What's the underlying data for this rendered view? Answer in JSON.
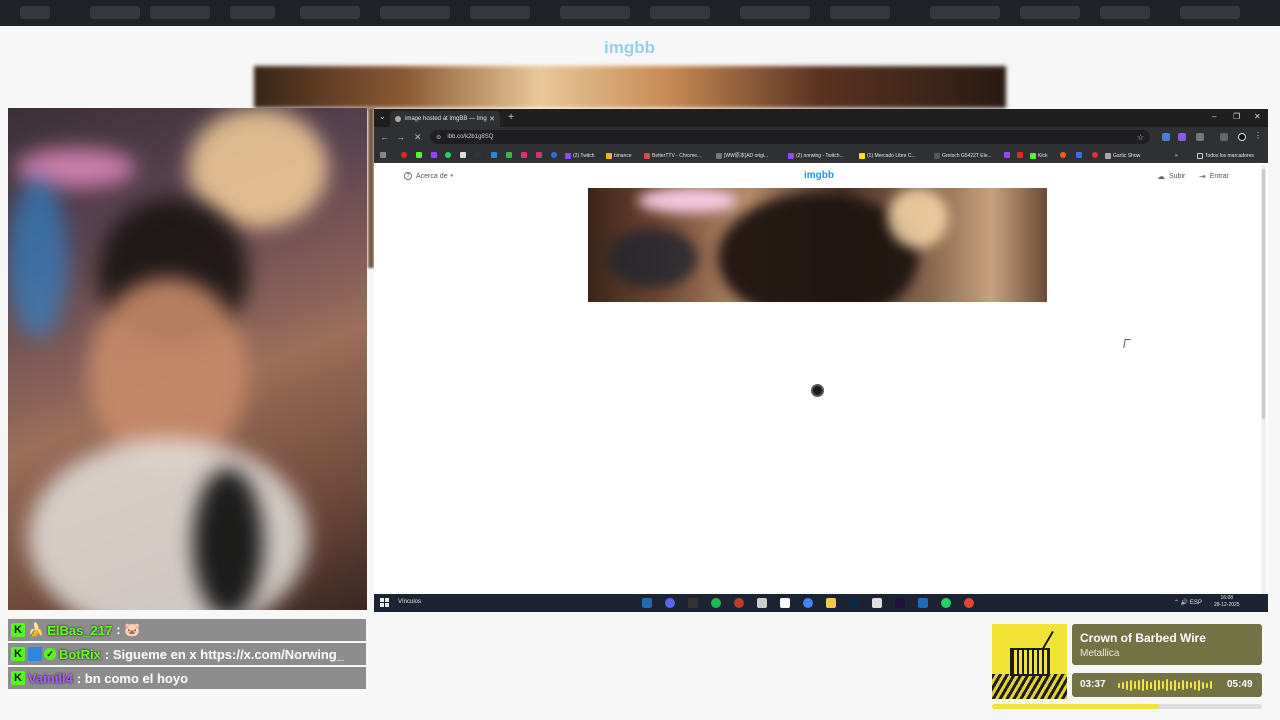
{
  "colors": {
    "imgbb_blue": "#1f9ad6",
    "kick_green": "#53fc18",
    "chat_bg": "#8d8d8d",
    "player_bg": "#727244",
    "player_accent": "#f0e339"
  },
  "browser": {
    "tab_title": "image hosted at ImgBB — Img",
    "url": "ibb.co/k2b1g8SQ",
    "bookmarks": [
      {
        "label": "(2) Twitch",
        "icon": "twitch-icon"
      },
      {
        "label": "binance",
        "icon": "binance-icon"
      },
      {
        "label": "BetterTTV - Chrome...",
        "icon": "bttv-icon"
      },
      {
        "label": "[WW原本]AD origi...",
        "icon": "bookmark-icon"
      },
      {
        "label": "(2) norwing - Twitch...",
        "icon": "twitch-icon"
      },
      {
        "label": "(1) Mercado Libre C...",
        "icon": "mercadolibre-icon"
      },
      {
        "label": "Gretsch G5422T Ele...",
        "icon": "bookmark-icon"
      },
      {
        "label": "Kick",
        "icon": "kick-icon"
      },
      {
        "label": "Gartic Show",
        "icon": "gartic-icon"
      }
    ],
    "all_bookmarks_label": "Todos los marcadores"
  },
  "site": {
    "about_label": "Acerca de",
    "logo": "imgbb",
    "upload_label": "Subir",
    "login_label": "Entrar"
  },
  "taskbar": {
    "label": "Vínculos",
    "lang": "ESP",
    "time": "16:08",
    "date": "28-12-2025"
  },
  "chat": {
    "messages": [
      {
        "user": "ElBas_217",
        "text": ": 🐷",
        "user_color": "green",
        "badges": [
          "kick-badge",
          "banana-badge"
        ]
      },
      {
        "user": "BotRix",
        "text": ": Sigueme en x https://x.com/Norwing_",
        "user_color": "green",
        "badges": [
          "kick-badge",
          "x-badge",
          "verified-badge"
        ]
      },
      {
        "user": "Vainill4",
        "text": ": bn como el hoyo",
        "user_color": "purple",
        "badges": [
          "kick-badge"
        ]
      }
    ]
  },
  "now_playing": {
    "title": "Crown of Barbed Wire",
    "artist": "Metallica",
    "elapsed": "03:37",
    "duration": "05:49",
    "progress": 0.62
  }
}
